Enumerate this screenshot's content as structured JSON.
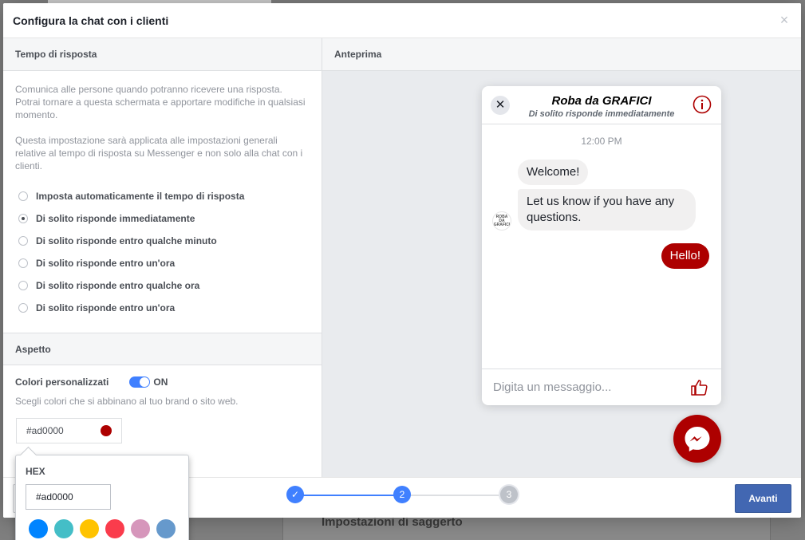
{
  "dialog": {
    "title": "Configura la chat con i clienti",
    "close_glyph": "×"
  },
  "background": {
    "bottom_text": "Impostazioni di saggerto"
  },
  "response_time": {
    "heading": "Tempo di risposta",
    "para1": "Comunica alle persone quando potranno ricevere una risposta. Potrai tornare a questa schermata e apportare modifiche in qualsiasi momento.",
    "para2": "Questa impostazione sarà applicata alle impostazioni generali relative al tempo di risposta su Messenger e non solo alla chat con i clienti.",
    "options": [
      "Imposta automaticamente il tempo di risposta",
      "Di solito risponde immediatamente",
      "Di solito risponde entro qualche minuto",
      "Di solito risponde entro un'ora",
      "Di solito risponde entro qualche ora",
      "Di solito risponde entro un'ora"
    ],
    "selected_index": 1
  },
  "appearance": {
    "heading": "Aspetto",
    "custom_colors_label": "Colori personalizzati",
    "toggle_text": "ON",
    "hint": "Scegli colori che si abbinano al tuo brand o sito web.",
    "color_value": "#ad0000"
  },
  "preview": {
    "heading": "Anteprima",
    "page_name": "Roba da GRAFICI",
    "subtitle": "Di solito risponde immediatamente",
    "time": "12:00 PM",
    "msg_welcome": "Welcome!",
    "msg_questions": "Let us know if you have any questions.",
    "msg_hello": "Hello!",
    "avatar_text": "ROBA DA GRAFICI",
    "input_placeholder": "Digita un messaggio...",
    "close_glyph": "✕"
  },
  "stepper": {
    "steps": [
      "✓",
      "2",
      "3"
    ],
    "current": 2
  },
  "footer": {
    "next_label": "Avanti"
  },
  "popover": {
    "label": "HEX",
    "value": "#ad0000",
    "swatches": [
      "#0084ff",
      "#44bec7",
      "#ffc300",
      "#fa3c4c",
      "#d696bb",
      "#6699cc"
    ]
  },
  "colors": {
    "accent": "#ad0000",
    "fb_blue": "#4267b2",
    "step_blue": "#4080ff",
    "step_gray": "#bec2c9"
  }
}
